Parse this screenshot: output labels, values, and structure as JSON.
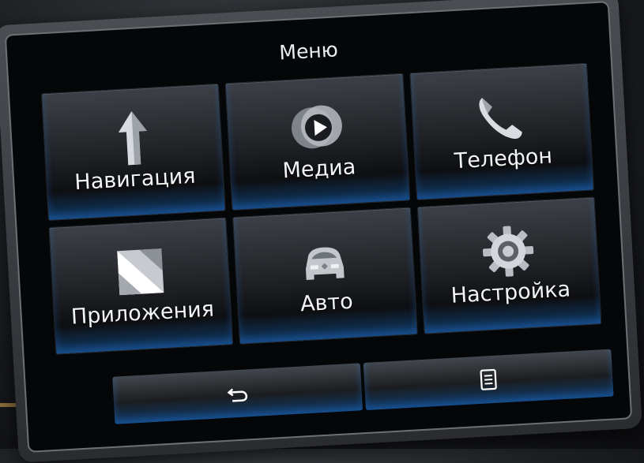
{
  "header": {
    "title": "Меню"
  },
  "menu": {
    "tiles": [
      {
        "label": "Навигация",
        "icon": "navigation-arrow-icon"
      },
      {
        "label": "Медиа",
        "icon": "media-play-icon"
      },
      {
        "label": "Телефон",
        "icon": "phone-handset-icon"
      },
      {
        "label": "Приложения",
        "icon": "apps-icon"
      },
      {
        "label": "Авто",
        "icon": "car-icon"
      },
      {
        "label": "Настройка",
        "icon": "gear-icon"
      }
    ]
  },
  "bottom_bar": {
    "back_icon": "back-arrow-icon",
    "options_icon": "list-icon"
  },
  "colors": {
    "accent": "#1f6fd0",
    "text": "#f2f4f6",
    "tile_dark": "#1d1f23"
  }
}
